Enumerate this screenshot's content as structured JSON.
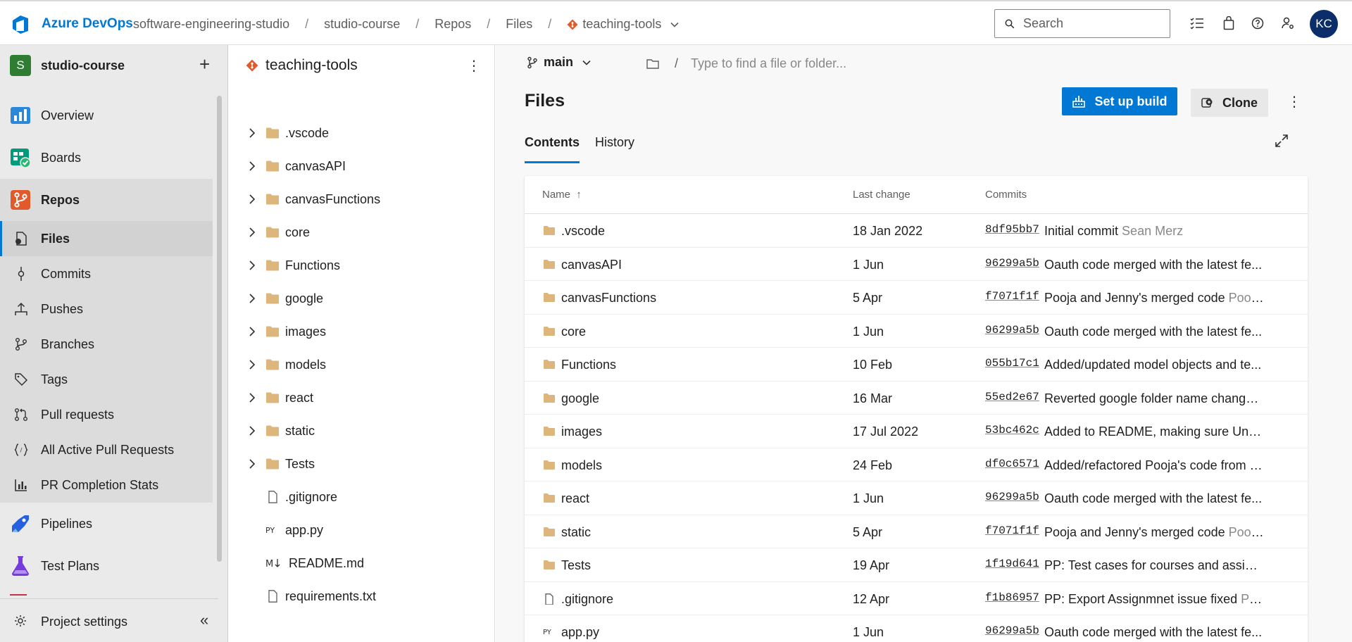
{
  "header": {
    "brand": "Azure DevOps",
    "breadcrumbs": [
      "software-engineering-studio",
      "studio-course",
      "Repos",
      "Files",
      "teaching-tools"
    ],
    "search_placeholder": "Search",
    "avatar_initials": "KC"
  },
  "sidebar": {
    "project_initial": "S",
    "project_name": "studio-course",
    "items": [
      {
        "label": "Overview"
      },
      {
        "label": "Boards"
      },
      {
        "label": "Repos"
      },
      {
        "label": "Files"
      },
      {
        "label": "Commits"
      },
      {
        "label": "Pushes"
      },
      {
        "label": "Branches"
      },
      {
        "label": "Tags"
      },
      {
        "label": "Pull requests"
      },
      {
        "label": "All Active Pull Requests"
      },
      {
        "label": "PR Completion Stats"
      },
      {
        "label": "Pipelines"
      },
      {
        "label": "Test Plans"
      }
    ],
    "settings_label": "Project settings"
  },
  "tree": {
    "repo_name": "teaching-tools",
    "items": [
      {
        "label": ".vscode",
        "type": "folder"
      },
      {
        "label": "canvasAPI",
        "type": "folder"
      },
      {
        "label": "canvasFunctions",
        "type": "folder"
      },
      {
        "label": "core",
        "type": "folder"
      },
      {
        "label": "Functions",
        "type": "folder"
      },
      {
        "label": "google",
        "type": "folder"
      },
      {
        "label": "images",
        "type": "folder"
      },
      {
        "label": "models",
        "type": "folder"
      },
      {
        "label": "react",
        "type": "folder"
      },
      {
        "label": "static",
        "type": "folder"
      },
      {
        "label": "Tests",
        "type": "folder"
      },
      {
        "label": ".gitignore",
        "type": "file"
      },
      {
        "label": "app.py",
        "type": "py"
      },
      {
        "label": "README.md",
        "type": "md"
      },
      {
        "label": "requirements.txt",
        "type": "file"
      }
    ]
  },
  "main": {
    "branch": "main",
    "path_placeholder": "Type to find a file or folder...",
    "title": "Files",
    "setup_build_label": "Set up build",
    "clone_label": "Clone",
    "tabs": [
      "Contents",
      "History"
    ],
    "columns": {
      "name": "Name",
      "sort_arrow": "↑",
      "last_change": "Last change",
      "commits": "Commits"
    },
    "rows": [
      {
        "name": ".vscode",
        "type": "folder",
        "date": "18 Jan 2022",
        "hash": "8df95bb7",
        "msg": "Initial commit",
        "author": "Sean Merz"
      },
      {
        "name": "canvasAPI",
        "type": "folder",
        "date": "1 Jun",
        "hash": "96299a5b",
        "msg": "Oauth code merged with the latest fe...",
        "author": ""
      },
      {
        "name": "canvasFunctions",
        "type": "folder",
        "date": "5 Apr",
        "hash": "f7071f1f",
        "msg": "Pooja and Jenny's merged code",
        "author": "Pooja..."
      },
      {
        "name": "core",
        "type": "folder",
        "date": "1 Jun",
        "hash": "96299a5b",
        "msg": "Oauth code merged with the latest fe...",
        "author": ""
      },
      {
        "name": "Functions",
        "type": "folder",
        "date": "10 Feb",
        "hash": "055b17c1",
        "msg": "Added/updated model objects and te...",
        "author": ""
      },
      {
        "name": "google",
        "type": "folder",
        "date": "16 Mar",
        "hash": "55ed2e67",
        "msg": "Reverted google folder name change ...",
        "author": ""
      },
      {
        "name": "images",
        "type": "folder",
        "date": "17 Jul 2022",
        "hash": "53bc462c",
        "msg": "Added to README, making sure Unit ...",
        "author": ""
      },
      {
        "name": "models",
        "type": "folder",
        "date": "24 Feb",
        "hash": "df0c6571",
        "msg": "Added/refactored Pooja's code from F...",
        "author": ""
      },
      {
        "name": "react",
        "type": "folder",
        "date": "1 Jun",
        "hash": "96299a5b",
        "msg": "Oauth code merged with the latest fe...",
        "author": ""
      },
      {
        "name": "static",
        "type": "folder",
        "date": "5 Apr",
        "hash": "f7071f1f",
        "msg": "Pooja and Jenny's merged code",
        "author": "Pooja..."
      },
      {
        "name": "Tests",
        "type": "folder",
        "date": "19 Apr",
        "hash": "1f19d641",
        "msg": "PP: Test cases for courses and assignm...",
        "author": ""
      },
      {
        "name": ".gitignore",
        "type": "file",
        "date": "12 Apr",
        "hash": "f1b86957",
        "msg": "PP: Export Assignmnet issue fixed",
        "author": "Poo..."
      },
      {
        "name": "app.py",
        "type": "py",
        "date": "1 Jun",
        "hash": "96299a5b",
        "msg": "Oauth code merged with the latest fe...",
        "author": ""
      }
    ]
  },
  "colors": {
    "accent": "#0078d4",
    "folder": "#dcb67a",
    "repo_icon": "#e05a2b"
  }
}
